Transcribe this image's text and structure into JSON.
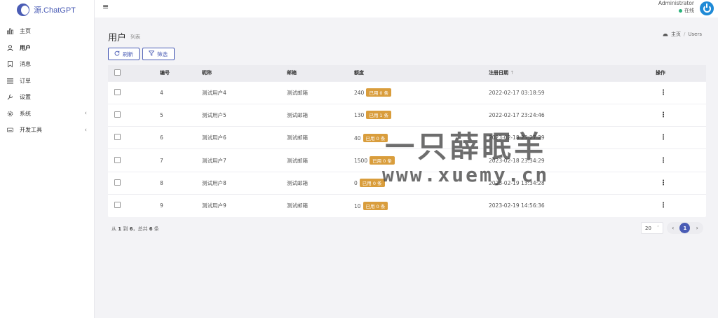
{
  "app": {
    "title": "源.ChatGPT"
  },
  "sidebar": {
    "items": [
      {
        "label": "主页",
        "icon": "bar-chart-icon"
      },
      {
        "label": "用户",
        "icon": "user-icon"
      },
      {
        "label": "消息",
        "icon": "bookmark-icon"
      },
      {
        "label": "订单",
        "icon": "list-icon"
      },
      {
        "label": "设置",
        "icon": "wrench-icon"
      },
      {
        "label": "系统",
        "icon": "gear-icon"
      },
      {
        "label": "开发工具",
        "icon": "keyboard-icon"
      }
    ]
  },
  "header": {
    "user_name": "Administrator",
    "status": "在线",
    "status_color": "#2ab27b"
  },
  "page": {
    "title": "用户",
    "subtitle": "列表",
    "breadcrumb": [
      "主页",
      "Users"
    ],
    "refresh_label": "刷新",
    "filter_label": "筛选"
  },
  "table": {
    "columns": [
      "编号",
      "昵称",
      "邮箱",
      "额度",
      "注册日期",
      "操作"
    ],
    "rows": [
      {
        "id": "4",
        "nickname": "测试用户4",
        "email": "测试邮箱",
        "quota": "240",
        "used": "已用 0 条",
        "date": "2022-02-17 03:18:59"
      },
      {
        "id": "5",
        "nickname": "测试用户5",
        "email": "测试邮箱",
        "quota": "130",
        "used": "已用 1 条",
        "date": "2022-02-17 23:24:46"
      },
      {
        "id": "6",
        "nickname": "测试用户6",
        "email": "测试邮箱",
        "quota": "40",
        "used": "已用 0 条",
        "date": "2023-02-18 23:27:29"
      },
      {
        "id": "7",
        "nickname": "测试用户7",
        "email": "测试邮箱",
        "quota": "1500",
        "used": "已用 0 条",
        "date": "2023-02-18 23:34:29"
      },
      {
        "id": "8",
        "nickname": "测试用户8",
        "email": "测试邮箱",
        "quota": "0",
        "used": "已用 0 条",
        "date": "2023-02-19 13:34:28"
      },
      {
        "id": "9",
        "nickname": "测试用户9",
        "email": "测试邮箱",
        "quota": "10",
        "used": "已用 0 条",
        "date": "2023-02-19 14:56:36"
      }
    ]
  },
  "footer": {
    "info_prefix": "从",
    "from": "1",
    "to_label": "到",
    "to": "6",
    "total_prefix": "，总共",
    "total": "6",
    "unit": "条",
    "page_size": "20",
    "current_page": "1"
  },
  "watermark": {
    "line1": "一只薛眠羊",
    "line2": "www.xuemy.cn"
  }
}
